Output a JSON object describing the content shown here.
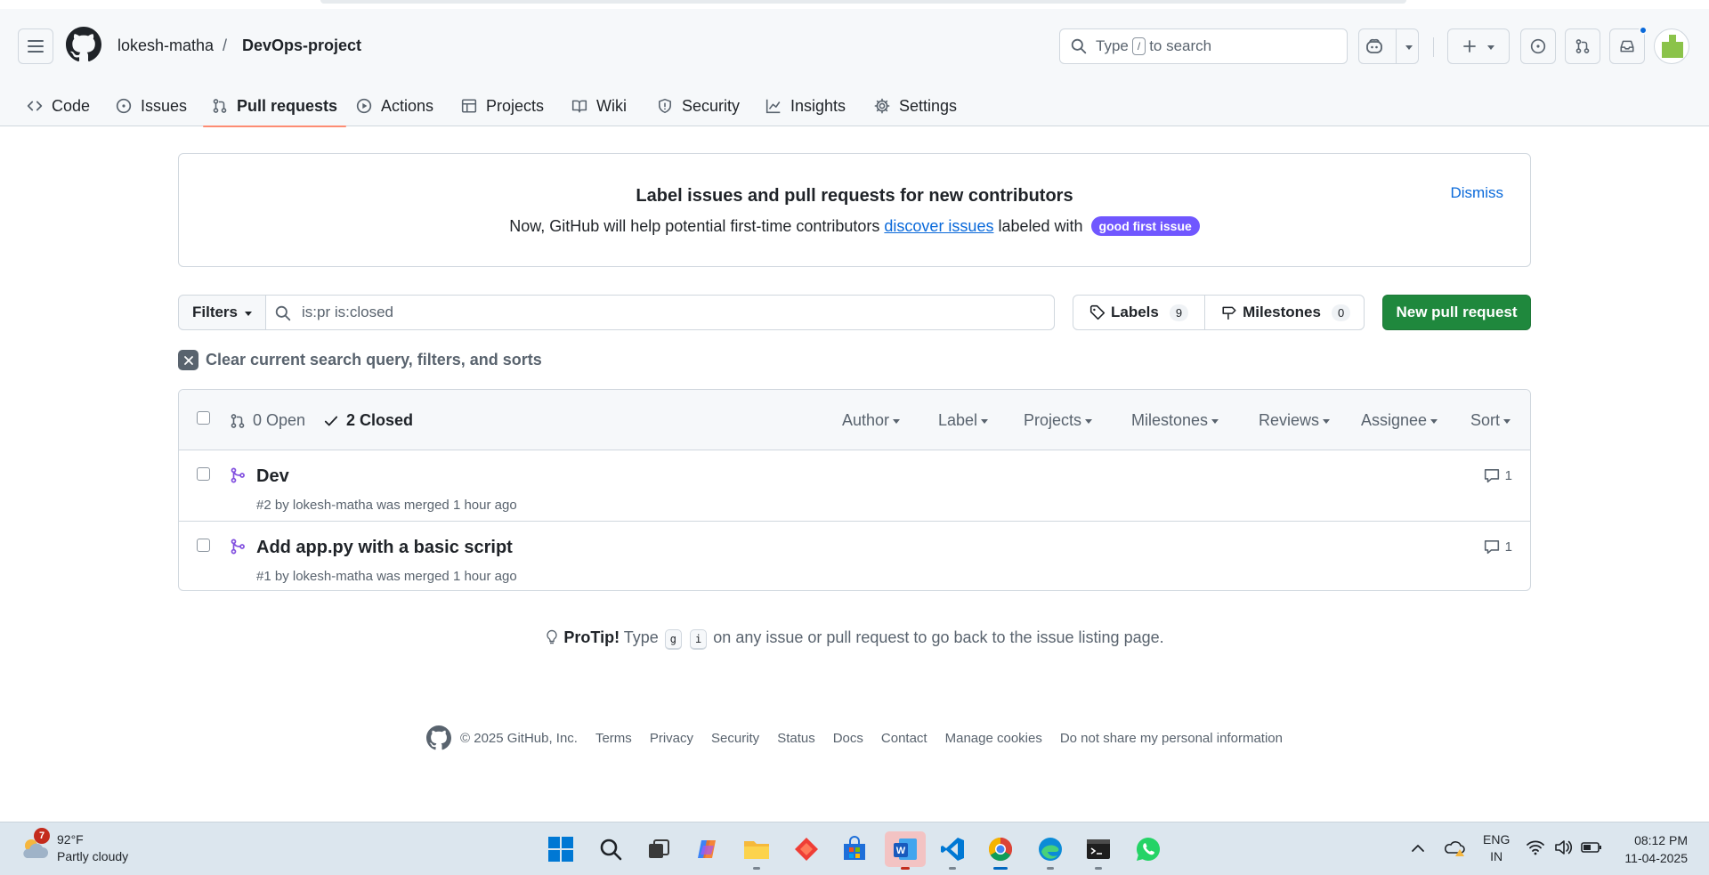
{
  "header": {
    "owner": "lokesh-matha",
    "separator": "/",
    "repo": "DevOps-project",
    "search_prefix": "Type",
    "search_key": "/",
    "search_suffix": "to search"
  },
  "tabs": [
    {
      "label": "Code",
      "icon": "code-icon"
    },
    {
      "label": "Issues",
      "icon": "issue-opened-icon"
    },
    {
      "label": "Pull requests",
      "icon": "git-pull-request-icon",
      "active": true
    },
    {
      "label": "Actions",
      "icon": "play-icon"
    },
    {
      "label": "Projects",
      "icon": "table-icon"
    },
    {
      "label": "Wiki",
      "icon": "book-icon"
    },
    {
      "label": "Security",
      "icon": "shield-icon"
    },
    {
      "label": "Insights",
      "icon": "graph-icon"
    },
    {
      "label": "Settings",
      "icon": "gear-icon"
    }
  ],
  "banner": {
    "title": "Label issues and pull requests for new contributors",
    "text_before": "Now, GitHub will help potential first-time contributors",
    "link": "discover issues",
    "text_after": "labeled with",
    "badge": "good first issue",
    "badge_color": "#7057ff",
    "dismiss": "Dismiss"
  },
  "toolbar": {
    "filters": "Filters",
    "query": "is:pr is:closed",
    "labels": "Labels",
    "labels_count": "9",
    "milestones": "Milestones",
    "milestones_count": "0",
    "new_pr": "New pull request",
    "new_pr_color": "#1f883d",
    "clear": "Clear current search query, filters, and sorts"
  },
  "list": {
    "open": "0 Open",
    "closed": "2 Closed",
    "filters": [
      "Author",
      "Label",
      "Projects",
      "Milestones",
      "Reviews",
      "Assignee",
      "Sort"
    ],
    "items": [
      {
        "title": "Dev",
        "meta": "#2 by lokesh-matha was merged 1 hour ago",
        "comments": "1"
      },
      {
        "title": "Add app.py with a basic script",
        "meta": "#1 by lokesh-matha was merged 1 hour ago",
        "comments": "1"
      }
    ]
  },
  "protip": {
    "label": "ProTip!",
    "before": "Type",
    "key1": "g",
    "key2": "i",
    "after": "on any issue or pull request to go back to the issue listing page."
  },
  "footer": {
    "copyright": "© 2025 GitHub, Inc.",
    "links": [
      "Terms",
      "Privacy",
      "Security",
      "Status",
      "Docs",
      "Contact",
      "Manage cookies",
      "Do not share my personal information"
    ]
  },
  "taskbar": {
    "weather_temp": "92°F",
    "weather_desc": "Partly cloudy",
    "weather_badge": "7",
    "lang_top": "ENG",
    "lang_bottom": "IN",
    "time": "08:12 PM",
    "date": "11-04-2025",
    "apps": [
      "windows-start-icon",
      "search-icon",
      "task-view-icon",
      "copilot-icon",
      "file-explorer-icon",
      "app-red-icon",
      "microsoft-store-icon",
      "word-icon",
      "vscode-icon",
      "chrome-icon",
      "edge-icon",
      "terminal-icon",
      "whatsapp-icon"
    ]
  }
}
